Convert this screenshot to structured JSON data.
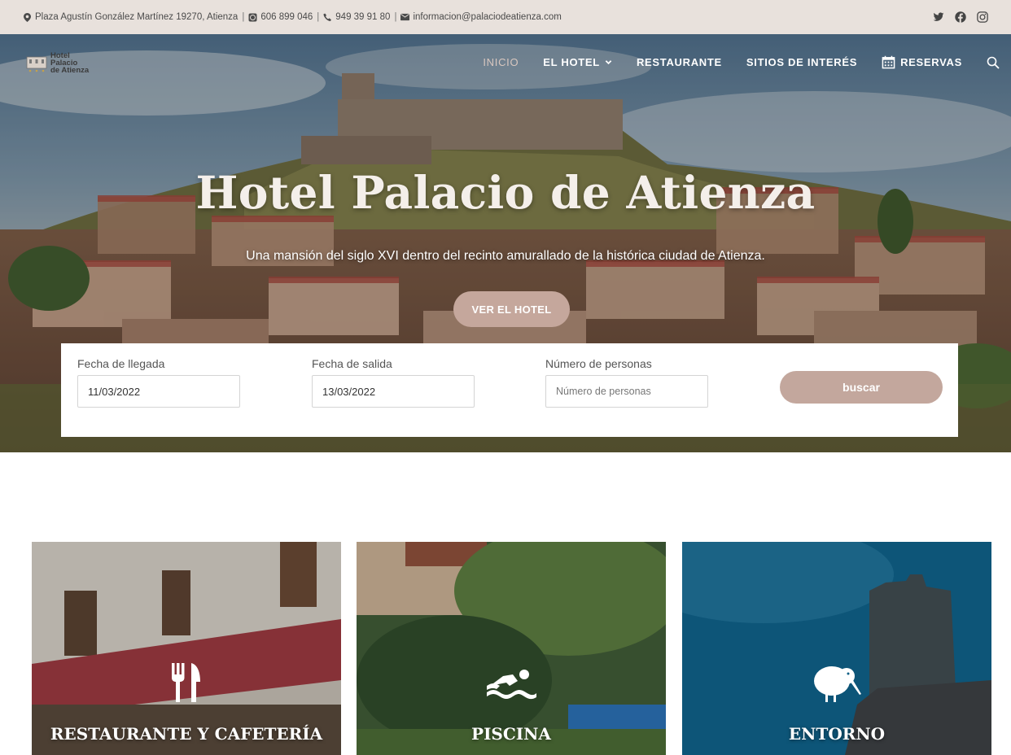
{
  "topbar": {
    "address": "Plaza Agustín González Martínez 19270, Atienza",
    "phone_whatsapp": "606 899 046",
    "phone": "949 39 91 80",
    "email": "informacion@palaciodeatienza.com",
    "social": [
      "twitter-icon",
      "facebook-icon",
      "instagram-icon"
    ]
  },
  "logo": {
    "line1": "Hotel",
    "line2": "Palacio",
    "line3": "de Atienza"
  },
  "nav": {
    "inicio": "INICIO",
    "el_hotel": "EL HOTEL",
    "restaurante": "RESTAURANTE",
    "sitios": "SITIOS DE INTERÉS",
    "reservas": "RESERVAS"
  },
  "hero": {
    "title": "Hotel Palacio de Atienza",
    "subtitle": "Una mansión del siglo XVI dentro del recinto amurallado de la histórica ciudad de Atienza.",
    "button": "VER EL HOTEL"
  },
  "booking": {
    "arrival_label": "Fecha de llegada",
    "arrival_value": "11/03/2022",
    "departure_label": "Fecha de salida",
    "departure_value": "13/03/2022",
    "people_label": "Número de personas",
    "people_placeholder": "Número de personas",
    "submit": "buscar"
  },
  "cards": [
    {
      "title": "RESTAURANTE Y CAFETERÍA",
      "icon": "utensils-icon"
    },
    {
      "title": "PISCINA",
      "icon": "swimmer-icon"
    },
    {
      "title": "ENTORNO",
      "icon": "kiwi-bird-icon"
    }
  ],
  "colors": {
    "topbar_bg": "#e8e1dc",
    "accent": "#c5a79c",
    "nav_active": "#d9c7bf"
  }
}
